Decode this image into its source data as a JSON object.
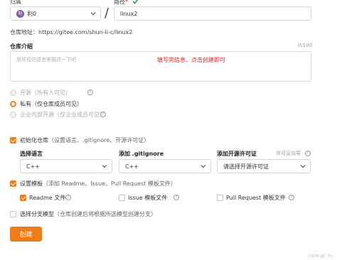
{
  "owner": {
    "label": "归属",
    "avatar_text": "利",
    "value": "利0"
  },
  "path": {
    "label": "路径",
    "required_mark": "*",
    "separator": "/",
    "value": "linux2"
  },
  "repo_address": "仓库地址：https://gitee.com/shun-li-c/linux2",
  "intro": {
    "label": "仓库介绍",
    "counter": "0/100",
    "placeholder": "用简短的语言来描述一下吧",
    "annotation": "填写完信息，点击创建即可"
  },
  "visibility": {
    "options": [
      {
        "label": "开源（所有人可见）",
        "selected": false,
        "disabled": true
      },
      {
        "label": "私有（仅仓库成员可见）",
        "selected": true,
        "disabled": false
      },
      {
        "label": "企业内部开源（仅企业成员可见）",
        "selected": false,
        "disabled": true
      }
    ]
  },
  "init_repo": {
    "label": "初始化仓库",
    "hint": "（设置语言、.gitignore、开源许可证）",
    "checked": true
  },
  "language": {
    "label": "选择语言",
    "value": "C++"
  },
  "gitignore": {
    "label": "添加 .gitignore",
    "value": "C++"
  },
  "license": {
    "label": "添加开源许可证",
    "help_link": "许可证向导",
    "value": "请选择开源许可证"
  },
  "template": {
    "label": "设置模板",
    "hint": "（添加 Readme、Issue、Pull Request 模板文件）",
    "checked": true,
    "items": [
      {
        "label": "Readme 文件",
        "checked": true
      },
      {
        "label": "Issue 模板文件",
        "checked": false
      },
      {
        "label": "Pull Request 模板文件",
        "checked": false
      }
    ]
  },
  "branch_model": {
    "label": "选择分支模型",
    "hint": "（仓库创建后将根据所选模型创建分支）",
    "checked": false
  },
  "create_button": "创建",
  "watermark": "CSDN @C_Try",
  "colors": {
    "accent": "#f07c1a",
    "annotation": "#e8201e",
    "check": "#2ea44f"
  }
}
